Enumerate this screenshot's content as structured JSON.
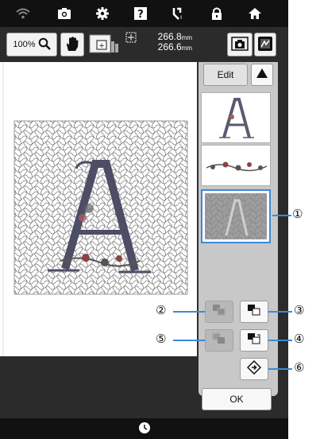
{
  "toolbar": {
    "zoom_label": "100%",
    "size_width": "266.8",
    "size_height": "266.6",
    "size_unit": "mm"
  },
  "panel": {
    "edit_label": "Edit",
    "ok_label": "OK"
  },
  "callouts": {
    "c1": "①",
    "c2": "②",
    "c3": "③",
    "c4": "④",
    "c5": "⑤",
    "c6": "⑥"
  },
  "colors": {
    "accent": "#3a8ad8",
    "bar": "#111111",
    "panel": "#c8c8c8"
  }
}
